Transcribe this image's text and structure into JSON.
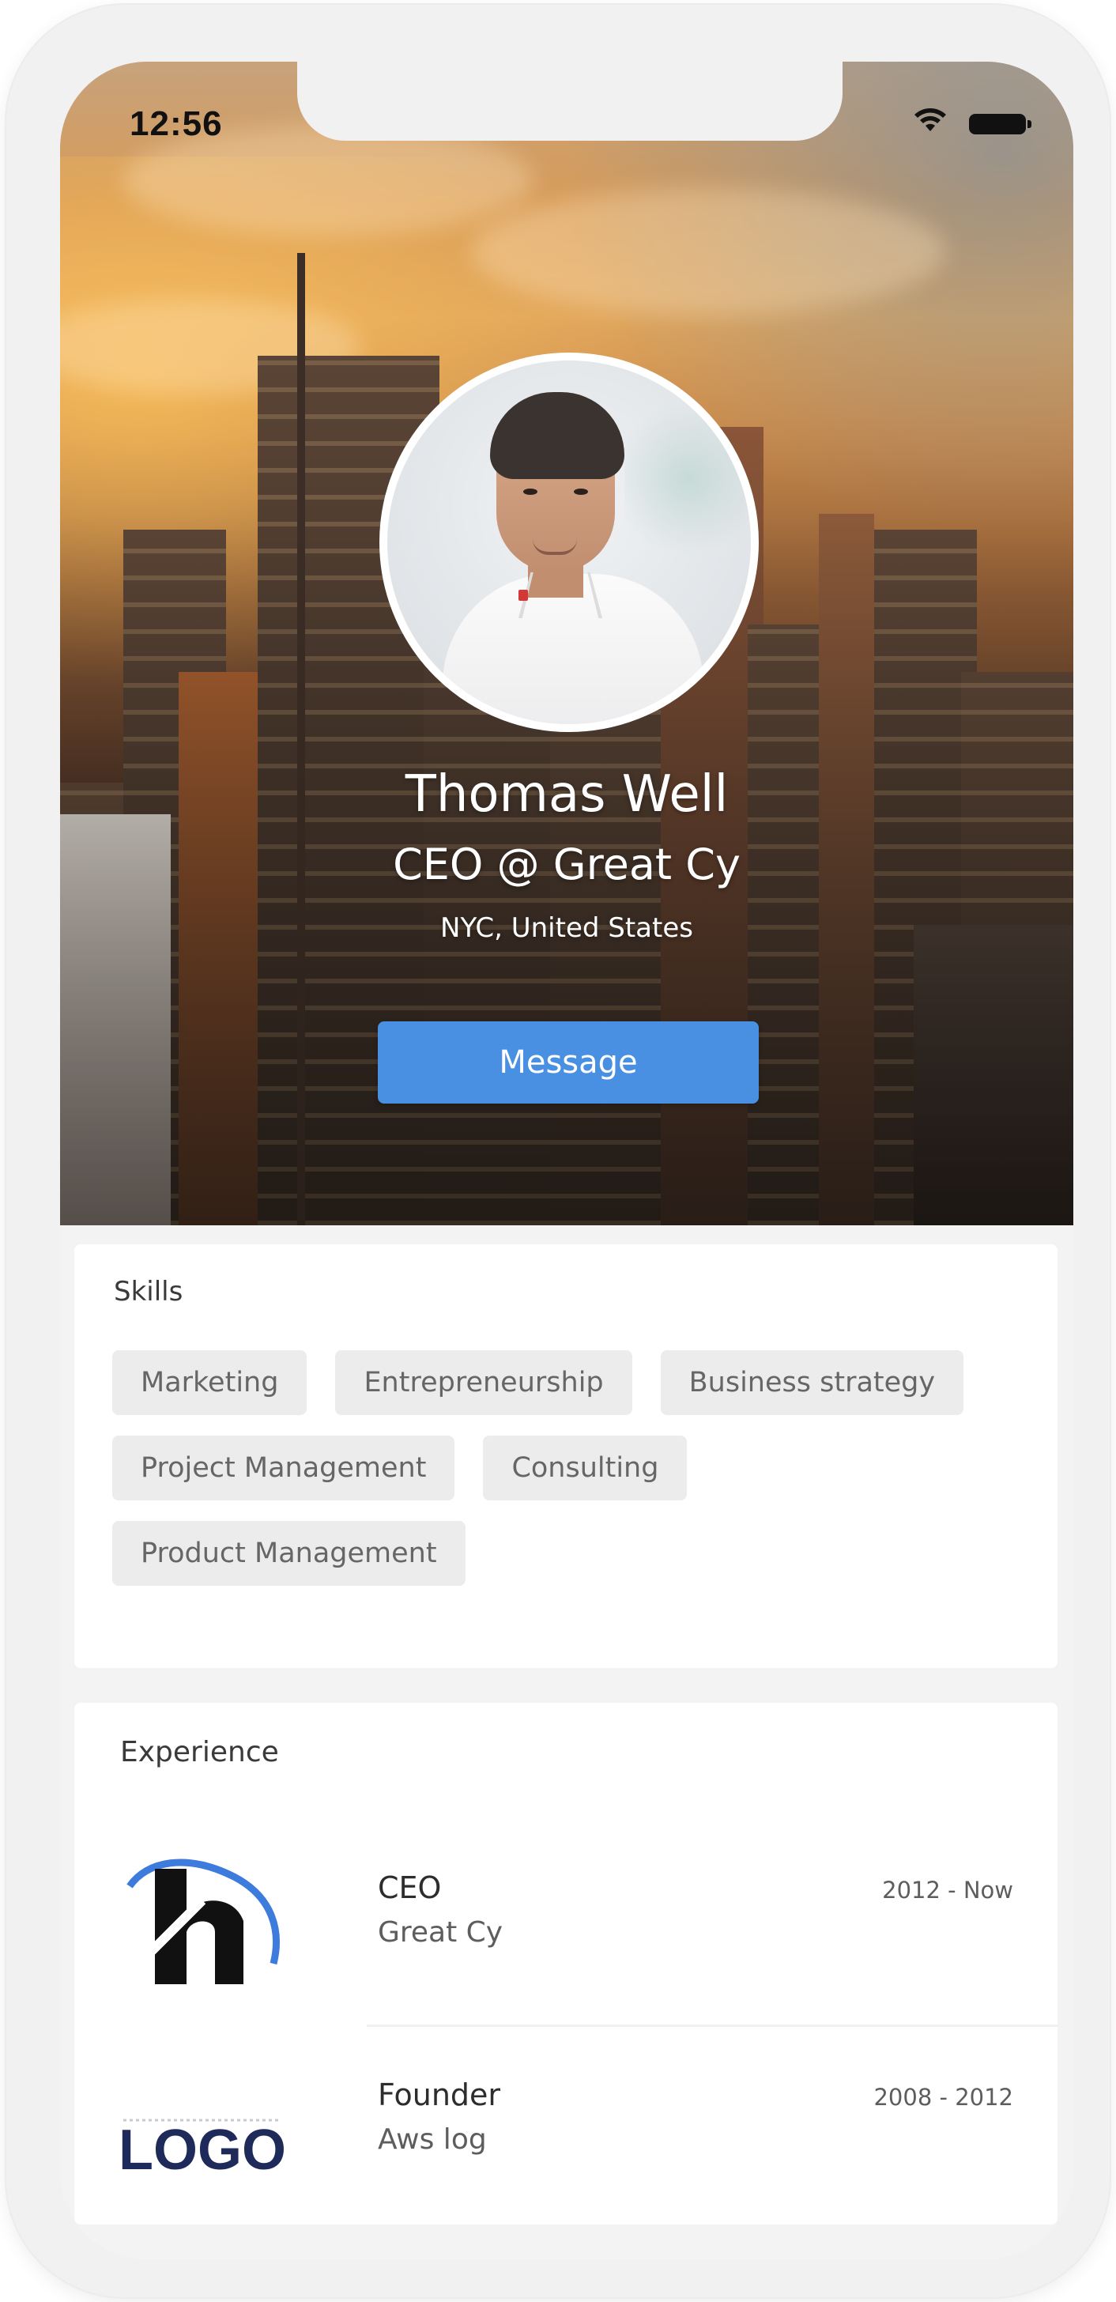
{
  "status_bar": {
    "time": "12:56",
    "icons": [
      "wifi-icon",
      "battery-icon"
    ]
  },
  "profile": {
    "name": "Thomas Well",
    "title": "CEO @ Great Cy",
    "location": "NYC, United States",
    "message_label": "Message",
    "accent_color": "#4a90e2"
  },
  "skills": {
    "title": "Skills",
    "items": [
      "Marketing",
      "Entrepreneurship",
      "Business strategy",
      "Project Management",
      "Consulting",
      "Product Management"
    ]
  },
  "experience": {
    "title": "Experience",
    "items": [
      {
        "role": "CEO",
        "company": "Great Cy",
        "period": "2012 - Now",
        "logo": "h-logo"
      },
      {
        "role": "Founder",
        "company": "Aws log",
        "period": "2008 - 2012",
        "logo": "logo-wordmark",
        "logo_text": "LOGO"
      }
    ]
  }
}
